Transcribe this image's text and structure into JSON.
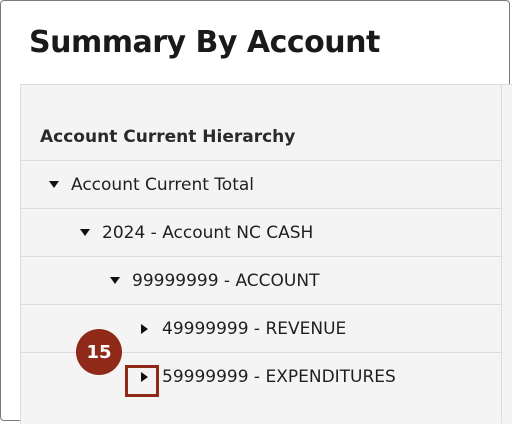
{
  "title": "Summary By Account",
  "tree": {
    "header": "Account Current Hierarchy",
    "rows": [
      {
        "label": "Account Current Total",
        "state": "expanded"
      },
      {
        "label": "2024 - Account NC CASH",
        "state": "expanded"
      },
      {
        "label": "99999999 - ACCOUNT",
        "state": "expanded"
      },
      {
        "label": "49999999 - REVENUE",
        "state": "collapsed"
      },
      {
        "label": "59999999 - EXPENDITURES",
        "state": "collapsed"
      }
    ]
  },
  "callout": {
    "step": "15",
    "color": "#8e2a17"
  },
  "icons": {
    "expanded": "caret-down-icon",
    "collapsed": "caret-right-icon"
  }
}
